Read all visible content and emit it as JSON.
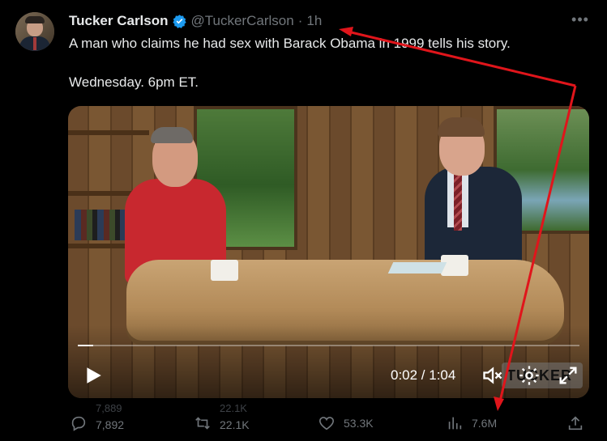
{
  "tweet": {
    "author_name": "Tucker Carlson",
    "handle": "@TuckerCarlson",
    "separator": "·",
    "time": "1h",
    "text_line1": "A man who claims he had sex with Barack Obama in 1999 tells his story.",
    "text_line2": "Wednesday. 6pm ET.",
    "more_icon": "more-horizontal-icon",
    "verified_color": "#1d9bf0"
  },
  "video": {
    "timecode": "0:02 / 1:04",
    "progress": 0.03,
    "watermark": "TUCKER"
  },
  "actions": {
    "reply_count": "7,892",
    "reply_count_prev": "7,889",
    "retweet_count": "22.1K",
    "retweet_count_prev": "22.1K",
    "like_count": "53.3K",
    "views_count": "7.6M"
  },
  "annotation": {
    "arrow_color": "#e0151b"
  }
}
